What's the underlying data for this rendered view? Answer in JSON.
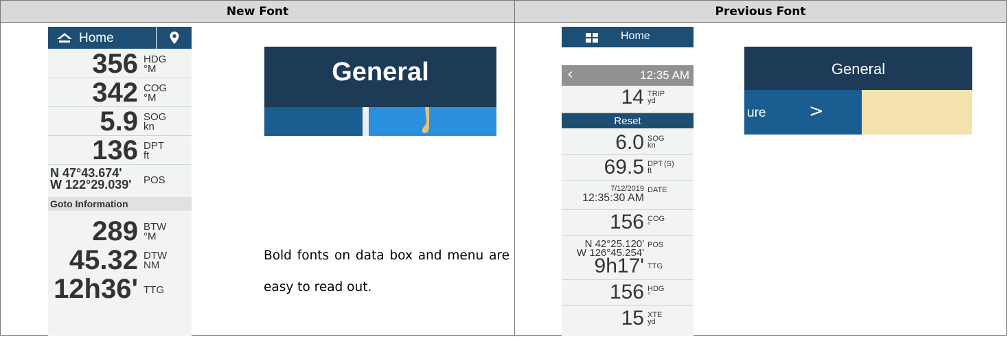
{
  "headers": {
    "new": "New Font",
    "previous": "Previous Font"
  },
  "new_panel": {
    "home": "Home",
    "rows": [
      {
        "value": "356",
        "label1": "HDG",
        "label2": "°M"
      },
      {
        "value": "342",
        "label1": "COG",
        "label2": "°M"
      },
      {
        "value": "5.9",
        "label1": "SOG",
        "label2": "kn"
      },
      {
        "value": "136",
        "label1": "DPT",
        "label2": "ft"
      }
    ],
    "pos_line1": "N 47°43.674'",
    "pos_line2": "W 122°29.039'",
    "pos_label": "POS",
    "goto": "Goto Information",
    "rows2": [
      {
        "value": "289",
        "label1": "BTW",
        "label2": "°M"
      },
      {
        "value": "45.32",
        "label1": "DTW",
        "label2": "NM"
      },
      {
        "value": "12h36'",
        "label1": "TTG",
        "label2": ""
      }
    ]
  },
  "general_new": {
    "title": "General"
  },
  "caption": "Bold fonts on data box and menu are easy to read out.",
  "old_panel": {
    "home": "Home",
    "time": "12:35 AM",
    "trip_value": "14",
    "trip_label1": "TRIP",
    "trip_label2": "yd",
    "reset": "Reset",
    "sog_value": "6.0",
    "sog_label1": "SOG",
    "sog_label2": "kn",
    "dpt_value": "69.5",
    "dpt_label1": "DPT",
    "dpt_extra": "(S)",
    "dpt_label2": "ft",
    "date_line1": "7/12/2019",
    "date_line2": "12:35:30 AM",
    "date_label": "DATE",
    "cog_value": "156",
    "cog_label1": "COG",
    "cog_label2": "°",
    "pos_line1": "N 42°25.120'",
    "pos_line2": "W 126°45.254'",
    "pos_label": "POS",
    "ttg_value": "9h17'",
    "ttg_label": "TTG",
    "hdg_value": "156",
    "hdg_label1": "HDG",
    "hdg_label2": "°",
    "xte_value": "15",
    "xte_label1": "XTE",
    "xte_label2": "yd"
  },
  "general_old": {
    "title": "General",
    "partial": "ure",
    "chevron": ">"
  },
  "colors": {
    "navy": "#1d4e73",
    "header_gray": "#d9d9d9",
    "tan": "#f3e2ad"
  }
}
